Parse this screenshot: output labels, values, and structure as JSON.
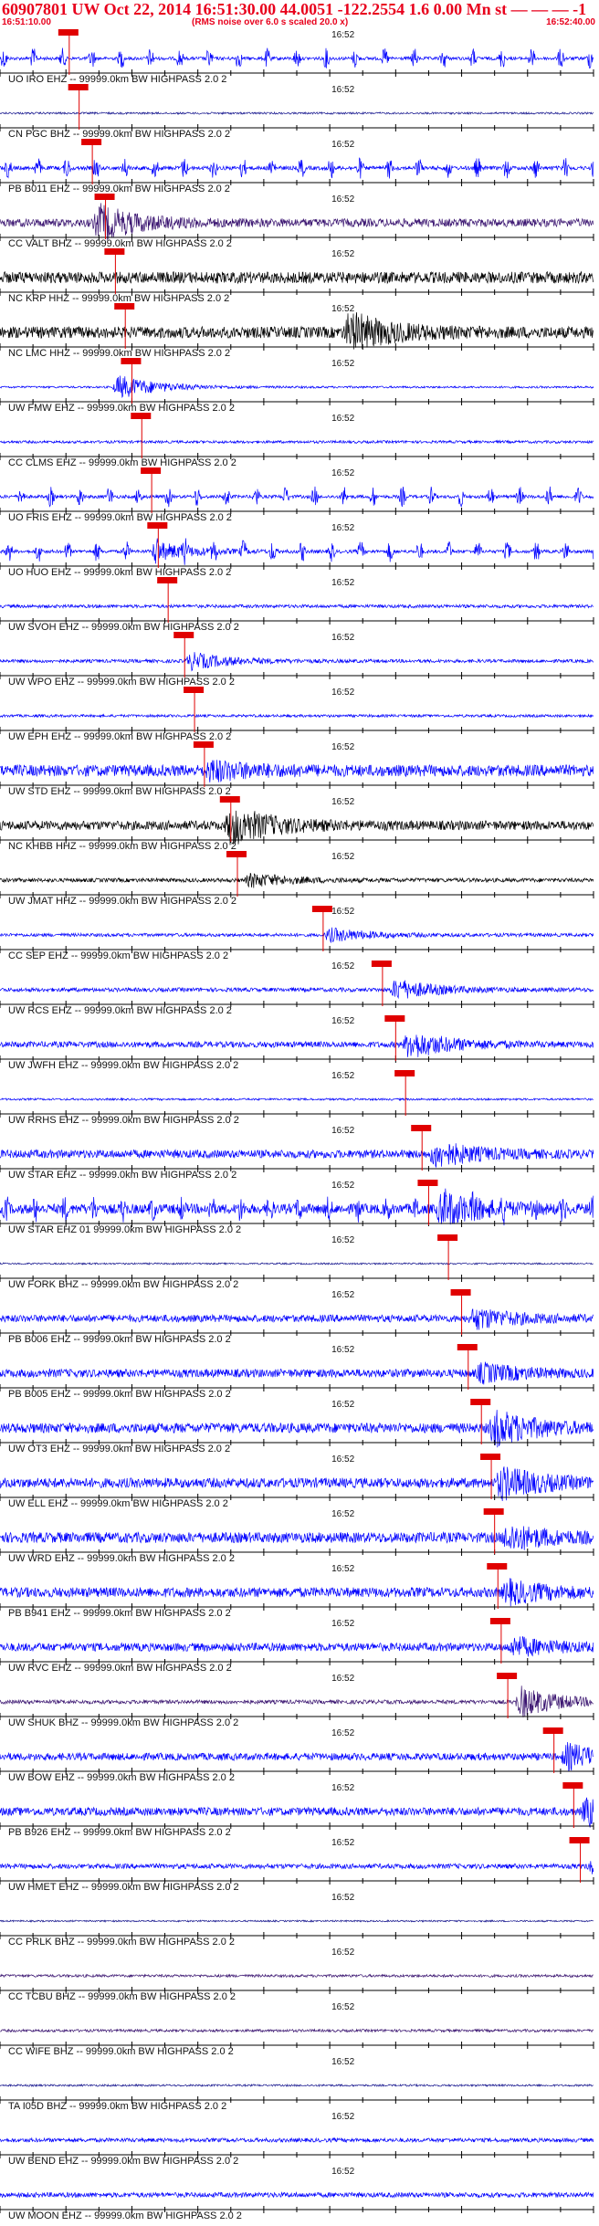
{
  "header": {
    "title": "60907801 UW Oct 22, 2014 16:51:30.00   44.0051 -122.2554  1.6 0.00 Mn st — — —  -1",
    "start_time": "16:51:10.00",
    "note": "(RMS noise over 6.0 s scaled 20.0 x)",
    "end_time": "16:52:40.00"
  },
  "chart_data": {
    "type": "line",
    "title": "60907801 UW Oct 22, 2014 16:51:30.00",
    "x_unit": "seconds after 16:51:10.00",
    "xlim": [
      0,
      90
    ],
    "minute_mark": {
      "label": "16:52",
      "t": 50
    },
    "traces": [
      {
        "label": "UO IRO EHZ -- 99999.0km BW  HIGHPASS  2.0  2",
        "color": "#0000ff",
        "pick_t": 10.5,
        "event_t": null,
        "event_amp": 0,
        "noise": 0.1,
        "bursts": true
      },
      {
        "label": "CN PGC BHZ -- 99999.0km BW  HIGHPASS  2.0  2",
        "color": "#1a1a90",
        "pick_t": 12.0,
        "event_t": null,
        "event_amp": 0,
        "noise": 0.06,
        "bursts": false
      },
      {
        "label": "PB B011 EHZ -- 99999.0km BW  HIGHPASS  2.0  2",
        "color": "#0000ff",
        "pick_t": 14.0,
        "event_t": null,
        "event_amp": 0,
        "noise": 0.12,
        "bursts": true
      },
      {
        "label": "CC VALT BHZ -- 99999.0km BW  HIGHPASS  2.0  2",
        "color": "#3a1470",
        "pick_t": 16.0,
        "event_t": 14,
        "event_amp": 1.0,
        "noise": 0.25,
        "bursts": false
      },
      {
        "label": "NC KRP HHZ -- 99999.0km BW  HIGHPASS  2.0  2",
        "color": "#000000",
        "pick_t": 17.5,
        "event_t": null,
        "event_amp": 0,
        "noise": 0.35,
        "bursts": false
      },
      {
        "label": "NC LMC HHZ -- 99999.0km BW  HIGHPASS  2.0  2",
        "color": "#000000",
        "pick_t": 19.0,
        "event_t": 52,
        "event_amp": 1.1,
        "noise": 0.35,
        "bursts": false
      },
      {
        "label": "UW FMW EHZ -- 99999.0km BW  HIGHPASS  2.0  2",
        "color": "#0000ff",
        "pick_t": 20.0,
        "event_t": 17,
        "event_amp": 0.7,
        "noise": 0.06,
        "bursts": false
      },
      {
        "label": "CC CLMS EHZ -- 99999.0km BW  HIGHPASS  2.0  2",
        "color": "#0000ff",
        "pick_t": 21.5,
        "event_t": null,
        "event_amp": 0,
        "noise": 0.08,
        "bursts": false
      },
      {
        "label": "UO FRIS EHZ -- 99999.0km BW  HIGHPASS  2.0  2",
        "color": "#0000ff",
        "pick_t": 23.0,
        "event_t": null,
        "event_amp": 0,
        "noise": 0.1,
        "bursts": true
      },
      {
        "label": "UO HUO EHZ -- 99999.0km BW  HIGHPASS  2.0  2",
        "color": "#0000ff",
        "pick_t": 24.0,
        "event_t": 23,
        "event_amp": 0.5,
        "noise": 0.1,
        "bursts": true
      },
      {
        "label": "UW SVOH EHZ -- 99999.0km BW  HIGHPASS  2.0  2",
        "color": "#0000ff",
        "pick_t": 25.5,
        "event_t": null,
        "event_amp": 0,
        "noise": 0.1,
        "bursts": false
      },
      {
        "label": "UW WPO EHZ -- 99999.0km BW  HIGHPASS  2.0  2",
        "color": "#0000ff",
        "pick_t": 28.0,
        "event_t": 28,
        "event_amp": 0.5,
        "noise": 0.1,
        "bursts": false
      },
      {
        "label": "UW EPH EHZ -- 99999.0km BW  HIGHPASS  2.0  2",
        "color": "#0000ff",
        "pick_t": 29.5,
        "event_t": null,
        "event_amp": 0,
        "noise": 0.08,
        "bursts": false
      },
      {
        "label": "UW STD EHZ -- 99999.0km BW  HIGHPASS  2.0  2",
        "color": "#0000ff",
        "pick_t": 31.0,
        "event_t": 31,
        "event_amp": 0.5,
        "noise": 0.35,
        "bursts": false
      },
      {
        "label": "NC KHBB HHZ -- 99999.0km BW  HIGHPASS  2.0  2",
        "color": "#000000",
        "pick_t": 35.0,
        "event_t": 34,
        "event_amp": 1.1,
        "noise": 0.28,
        "bursts": false
      },
      {
        "label": "UW JMAT HHZ -- 99999.0km BW  HIGHPASS  2.0  2",
        "color": "#000000",
        "pick_t": 36.0,
        "event_t": 37,
        "event_amp": 0.4,
        "noise": 0.12,
        "bursts": false
      },
      {
        "label": "CC SEP EHZ -- 99999.0km BW  HIGHPASS  2.0  2",
        "color": "#0000ff",
        "pick_t": 49.0,
        "event_t": 49,
        "event_amp": 0.4,
        "noise": 0.1,
        "bursts": false
      },
      {
        "label": "UW RCS EHZ -- 99999.0km BW  HIGHPASS  2.0  2",
        "color": "#0000ff",
        "pick_t": 58.0,
        "event_t": 59,
        "event_amp": 0.6,
        "noise": 0.12,
        "bursts": false
      },
      {
        "label": "UW JWFH EHZ -- 99999.0km BW  HIGHPASS  2.0  2",
        "color": "#0000ff",
        "pick_t": 60.0,
        "event_t": 61,
        "event_amp": 0.8,
        "noise": 0.18,
        "bursts": false
      },
      {
        "label": "UW RRHS EHZ -- 99999.0km BW  HIGHPASS  2.0  2",
        "color": "#0000ff",
        "pick_t": 61.5,
        "event_t": null,
        "event_amp": 0,
        "noise": 0.06,
        "bursts": false
      },
      {
        "label": "UW STAR EHZ -- 99999.0km BW  HIGHPASS  2.0  2",
        "color": "#0000ff",
        "pick_t": 64.0,
        "event_t": 65,
        "event_amp": 0.7,
        "noise": 0.25,
        "bursts": false
      },
      {
        "label": "UW STAR EHZ 01 99999.0km BW  HIGHPASS  2.0  2",
        "color": "#0000ff",
        "pick_t": 65.0,
        "event_t": 66,
        "event_amp": 1.0,
        "noise": 0.3,
        "bursts": true
      },
      {
        "label": "UW FORK BHZ -- 99999.0km BW  HIGHPASS  2.0  2",
        "color": "#1a1a90",
        "pick_t": 68.0,
        "event_t": null,
        "event_amp": 0,
        "noise": 0.05,
        "bursts": false
      },
      {
        "label": "PB B006 EHZ -- 99999.0km BW  HIGHPASS  2.0  2",
        "color": "#0000ff",
        "pick_t": 70.0,
        "event_t": 71,
        "event_amp": 0.6,
        "noise": 0.22,
        "bursts": false
      },
      {
        "label": "PB B005 EHZ -- 99999.0km BW  HIGHPASS  2.0  2",
        "color": "#0000ff",
        "pick_t": 71.0,
        "event_t": 72,
        "event_amp": 0.5,
        "noise": 0.25,
        "bursts": false
      },
      {
        "label": "UW OT3 EHZ -- 99999.0km BW  HIGHPASS  2.0  2",
        "color": "#0000ff",
        "pick_t": 73.0,
        "event_t": 74,
        "event_amp": 1.0,
        "noise": 0.3,
        "bursts": false
      },
      {
        "label": "UW ELL EHZ -- 99999.0km BW  HIGHPASS  2.0  2",
        "color": "#0000ff",
        "pick_t": 74.5,
        "event_t": 75,
        "event_amp": 0.9,
        "noise": 0.3,
        "bursts": false
      },
      {
        "label": "UW WRD EHZ -- 99999.0km BW  HIGHPASS  2.0  2",
        "color": "#0000ff",
        "pick_t": 75.0,
        "event_t": 76,
        "event_amp": 0.7,
        "noise": 0.32,
        "bursts": false
      },
      {
        "label": "PB B941 EHZ -- 99999.0km BW  HIGHPASS  2.0  2",
        "color": "#0000ff",
        "pick_t": 75.5,
        "event_t": 76,
        "event_amp": 0.6,
        "noise": 0.3,
        "bursts": false
      },
      {
        "label": "UW RVC EHZ -- 99999.0km BW  HIGHPASS  2.0  2",
        "color": "#0000ff",
        "pick_t": 76.0,
        "event_t": 77,
        "event_amp": 0.5,
        "noise": 0.25,
        "bursts": false
      },
      {
        "label": "UW SHUK BHZ -- 99999.0km BW  HIGHPASS  2.0  2",
        "color": "#3a1470",
        "pick_t": 77.0,
        "event_t": 78,
        "event_amp": 0.9,
        "noise": 0.12,
        "bursts": false
      },
      {
        "label": "UW BOW EHZ -- 99999.0km BW  HIGHPASS  2.0  2",
        "color": "#0000ff",
        "pick_t": 84.0,
        "event_t": 85,
        "event_amp": 0.7,
        "noise": 0.22,
        "bursts": false
      },
      {
        "label": "PB B926 EHZ -- 99999.0km BW  HIGHPASS  2.0  2",
        "color": "#0000ff",
        "pick_t": 87.0,
        "event_t": 88,
        "event_amp": 0.8,
        "noise": 0.25,
        "bursts": false
      },
      {
        "label": "UW HMET EHZ -- 99999.0km BW  HIGHPASS  2.0  2",
        "color": "#0000ff",
        "pick_t": 88.0,
        "event_t": 89,
        "event_amp": 0.5,
        "noise": 0.15,
        "bursts": false
      },
      {
        "label": "CC PRLK BHZ -- 99999.0km BW  HIGHPASS  2.0  2",
        "color": "#1a1a90",
        "pick_t": null,
        "event_t": null,
        "event_amp": 0,
        "noise": 0.05,
        "bursts": false
      },
      {
        "label": "CC TCBU BHZ -- 99999.0km BW  HIGHPASS  2.0  2",
        "color": "#3a1470",
        "pick_t": null,
        "event_t": null,
        "event_amp": 0,
        "noise": 0.08,
        "bursts": false
      },
      {
        "label": "CC WIFE BHZ -- 99999.0km BW  HIGHPASS  2.0  2",
        "color": "#3a1470",
        "pick_t": null,
        "event_t": null,
        "event_amp": 0,
        "noise": 0.08,
        "bursts": false
      },
      {
        "label": "TA I05D BHZ -- 99999.0km BW  HIGHPASS  2.0  2",
        "color": "#1a1a90",
        "pick_t": null,
        "event_t": null,
        "event_amp": 0,
        "noise": 0.06,
        "bursts": false
      },
      {
        "label": "UW BEND EHZ -- 99999.0km BW  HIGHPASS  2.0  2",
        "color": "#0000ff",
        "pick_t": null,
        "event_t": null,
        "event_amp": 0,
        "noise": 0.12,
        "bursts": false
      },
      {
        "label": "UW MOON EHZ -- 99999.0km BW  HIGHPASS  2.0  2",
        "color": "#0000ff",
        "pick_t": null,
        "event_t": null,
        "event_amp": 0,
        "noise": 0.15,
        "bursts": false
      }
    ]
  }
}
